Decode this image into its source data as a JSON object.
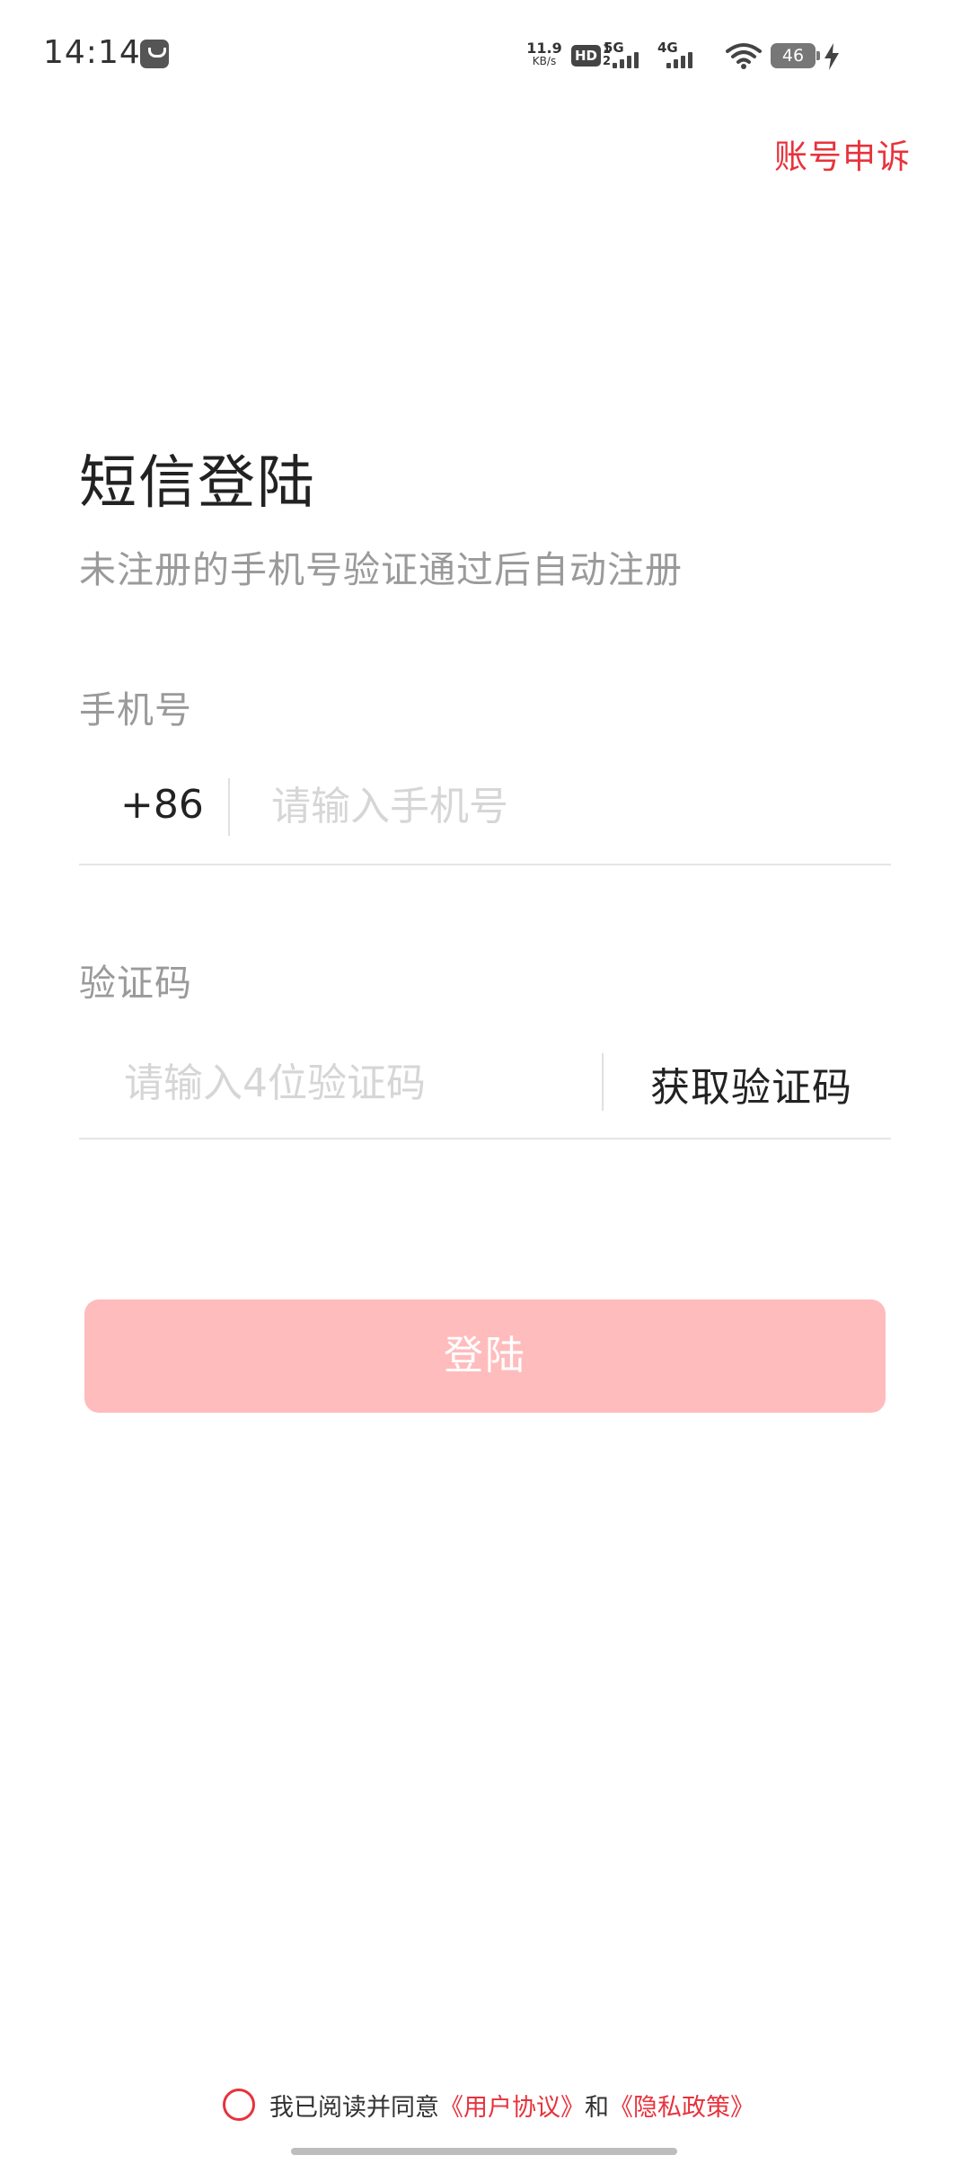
{
  "status_bar": {
    "time": "14:14",
    "net_speed_value": "11.9",
    "net_speed_unit": "KB/s",
    "hd_label": "HD",
    "hd_sub": "1\n2",
    "net1": "5G",
    "net2": "4G",
    "battery": "46"
  },
  "header": {
    "appeal_link": "账号申诉"
  },
  "login": {
    "title": "短信登陆",
    "subtitle": "未注册的手机号验证通过后自动注册",
    "phone_label": "手机号",
    "country_code": "+86",
    "phone_placeholder": "请输入手机号",
    "code_label": "验证码",
    "code_placeholder": "请输入4位验证码",
    "get_code": "获取验证码",
    "login_button": "登陆"
  },
  "agreement": {
    "prefix": "我已阅读并同意",
    "user_agreement": "《用户协议》",
    "conjunction": "和",
    "privacy_policy": "《隐私政策》"
  },
  "colors": {
    "accent": "#e8323c",
    "button_disabled": "#ffbcbd",
    "muted_text": "#9a9a9a",
    "placeholder": "#d6d6d6"
  }
}
